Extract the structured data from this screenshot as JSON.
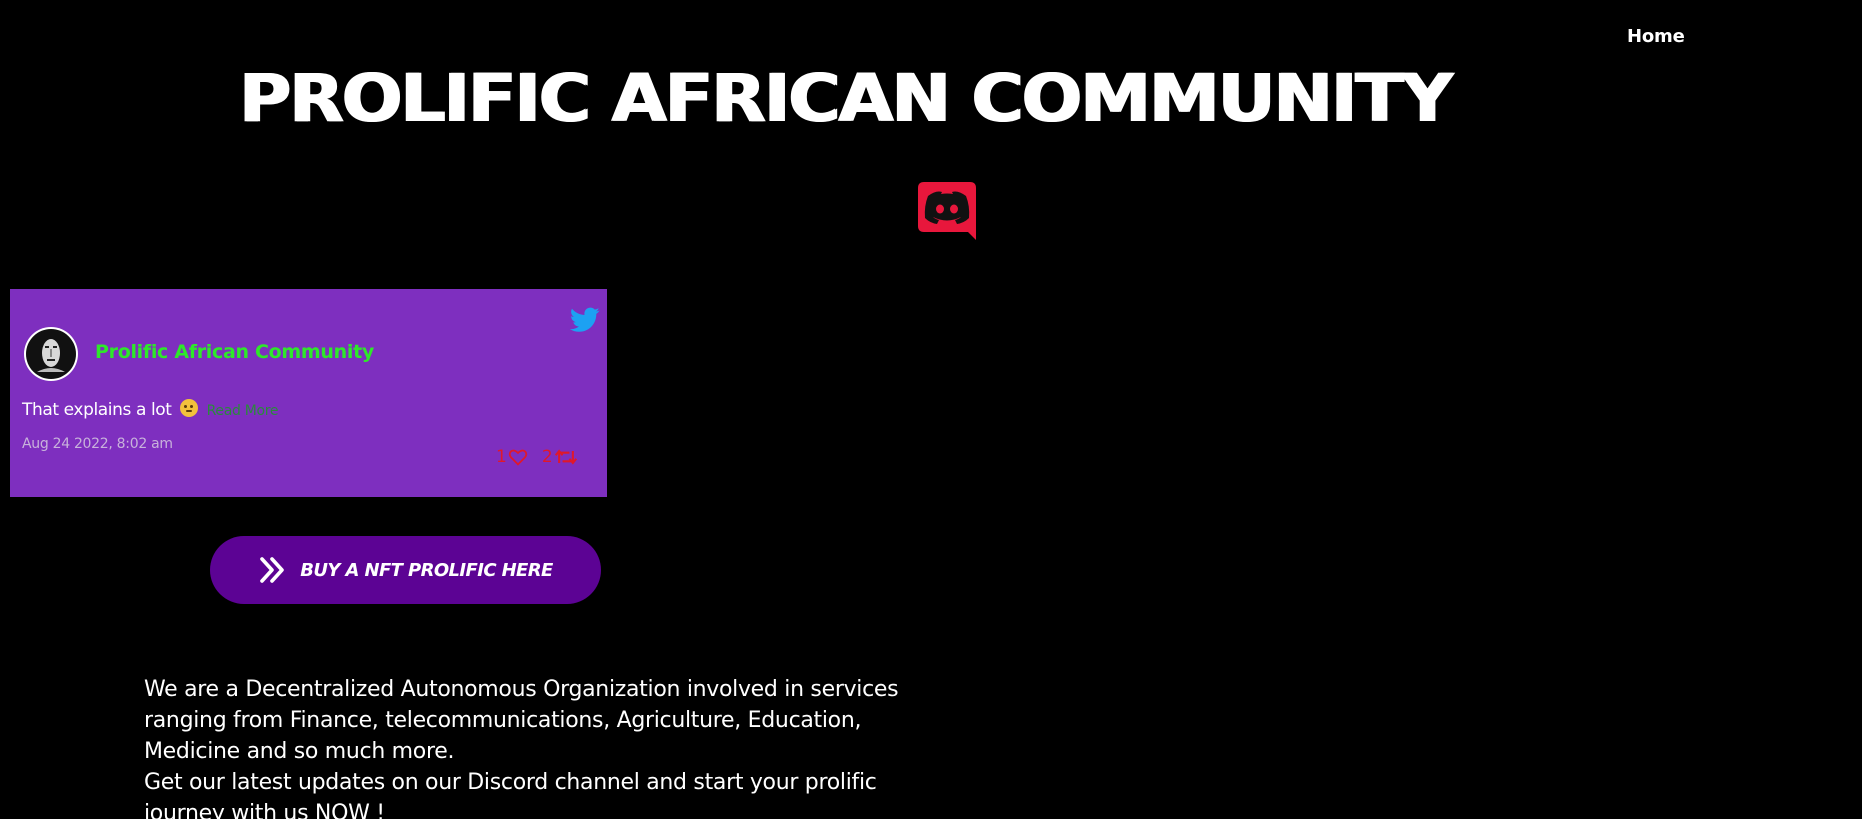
{
  "nav": {
    "home_label": "Home"
  },
  "hero": {
    "title": "PROLIFIC AFRICAN COMMUNITY",
    "discord_icon": "discord-icon",
    "discord_color": "#e8173c"
  },
  "tweet": {
    "author": "Prolific African Community",
    "text": "That explains a lot",
    "emoji": "thinking-face-emoji",
    "read_more": "Read More",
    "date": "Aug 24 2022, 8:02 am",
    "likes": "1",
    "retweets": "2",
    "card_color": "#7e2fbf",
    "author_color": "#2ee82a",
    "action_color": "#e0182a",
    "twitter_icon": "twitter-bird-icon"
  },
  "buy_button": {
    "label": "BUY A NFT PROLIFIC HERE",
    "icon": "double-chevron-right-icon",
    "color": "#5c0394"
  },
  "about": {
    "paragraph1": "We are a Decentralized Autonomous Organization involved in services ranging from Finance, telecommunications, Agriculture, Education, Medicine and so much more.",
    "paragraph2": "Get our latest updates on our Discord channel and start your prolific journey with us NOW !"
  }
}
